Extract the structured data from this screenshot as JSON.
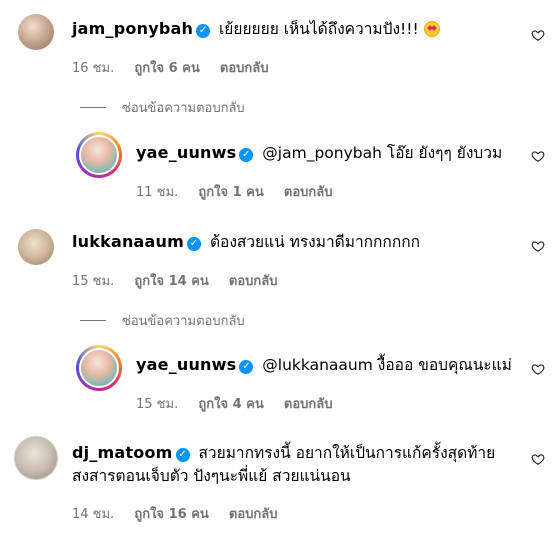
{
  "comments": [
    {
      "username": "jam_ponybah",
      "text": "เย้ยยยยย เห็นได้ถึงความปัง!!!",
      "emoji": "heart-eyes-emoji",
      "time": "16 ชม.",
      "likes": "ถูกใจ 6 คน",
      "reply": "ตอบกลับ"
    },
    {
      "username": "yae_uunws",
      "mention": "@jam_ponybah",
      "text": "โอ๊ย ยังๆๆ ยังบวม",
      "time": "11 ชม.",
      "likes": "ถูกใจ 1 คน",
      "reply": "ตอบกลับ"
    },
    {
      "username": "lukkanaaum",
      "text": "ต้องสวยแน่ ทรงมาดีมากกกกกก",
      "time": "15 ชม.",
      "likes": "ถูกใจ 14 คน",
      "reply": "ตอบกลับ"
    },
    {
      "username": "yae_uunws",
      "mention": "@lukkanaaum",
      "text": "งื้อออ ขอบคุณนะแม่",
      "time": "15 ชม.",
      "likes": "ถูกใจ 4 คน",
      "reply": "ตอบกลับ"
    },
    {
      "username": "dj_matoom",
      "text_line1": "สวยมากทรงนี้ อยากให้เป็นการแก้ครั้งสุดท้าย",
      "text_line2": "สงสารตอนเจ็บตัว ปังๆนะพี่แย้ สวยแน่นอน",
      "time": "14 ชม.",
      "likes": "ถูกใจ 16 คน",
      "reply": "ตอบกลับ"
    }
  ],
  "hide_replies_label": "ซ่อนข้อความตอบกลับ",
  "verified_icon": "verified-badge-icon",
  "like_icon": "heart-outline-icon",
  "colors": {
    "verified": "#0095f6",
    "meta": "#737373"
  }
}
